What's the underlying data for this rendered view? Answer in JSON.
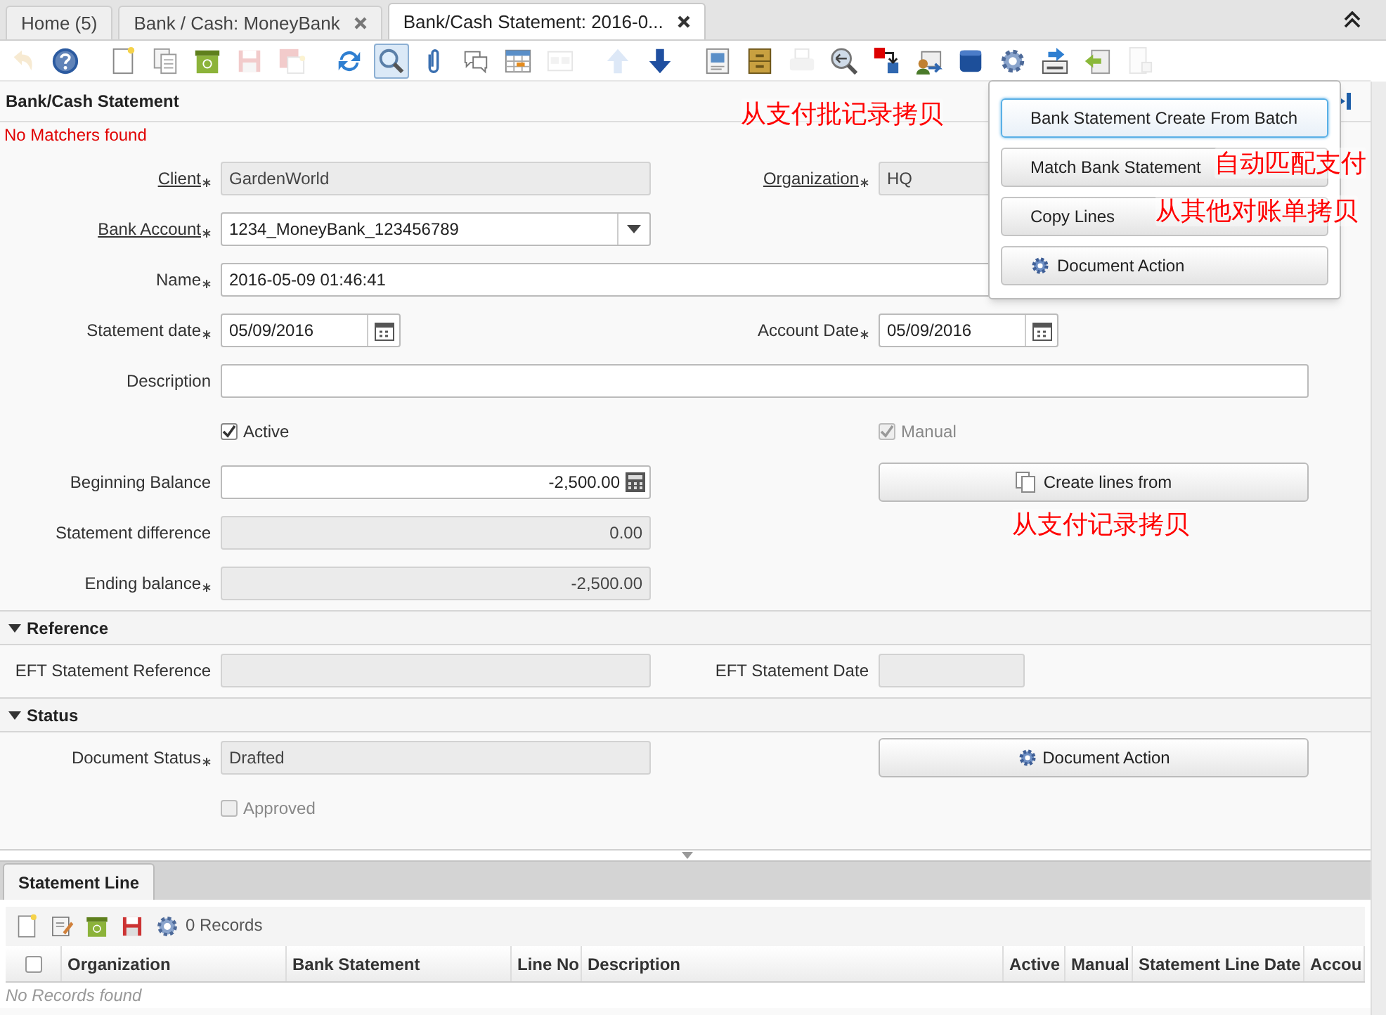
{
  "tabs": [
    {
      "label": "Home (5)",
      "closable": false,
      "selected": false
    },
    {
      "label": "Bank / Cash: MoneyBank",
      "closable": true,
      "selected": false
    },
    {
      "label": "Bank/Cash Statement: 2016-0...",
      "closable": true,
      "selected": true
    }
  ],
  "toolbar": [
    [
      {
        "kind": "undo",
        "disabled": true,
        "selected": false
      },
      {
        "kind": "help",
        "disabled": false,
        "selected": false
      }
    ],
    [
      {
        "kind": "new",
        "disabled": false,
        "selected": false
      },
      {
        "kind": "copy",
        "disabled": false,
        "selected": false
      },
      {
        "kind": "delete",
        "disabled": false,
        "selected": false
      },
      {
        "kind": "save",
        "disabled": true,
        "selected": false
      },
      {
        "kind": "savenew",
        "disabled": true,
        "selected": false
      }
    ],
    [
      {
        "kind": "refresh",
        "disabled": false,
        "selected": false
      },
      {
        "kind": "find",
        "disabled": false,
        "selected": true
      },
      {
        "kind": "attach",
        "disabled": false,
        "selected": false
      },
      {
        "kind": "chat",
        "disabled": false,
        "selected": false
      },
      {
        "kind": "grid",
        "disabled": false,
        "selected": false
      },
      {
        "kind": "form",
        "disabled": true,
        "selected": false
      }
    ],
    [
      {
        "kind": "up",
        "disabled": true,
        "selected": false
      },
      {
        "kind": "down",
        "disabled": false,
        "selected": false
      }
    ],
    [
      {
        "kind": "report",
        "disabled": false,
        "selected": false
      },
      {
        "kind": "archive",
        "disabled": false,
        "selected": false
      },
      {
        "kind": "print",
        "disabled": true,
        "selected": false
      },
      {
        "kind": "zoom",
        "disabled": false,
        "selected": false
      },
      {
        "kind": "workflow",
        "disabled": false,
        "selected": false
      },
      {
        "kind": "requests",
        "disabled": false,
        "selected": false
      },
      {
        "kind": "product",
        "disabled": false,
        "selected": false
      },
      {
        "kind": "process",
        "disabled": false,
        "selected": false
      },
      {
        "kind": "download",
        "disabled": false,
        "selected": false
      },
      {
        "kind": "import",
        "disabled": false,
        "selected": false
      },
      {
        "kind": "export",
        "disabled": true,
        "selected": false
      }
    ]
  ],
  "form": {
    "title": "Bank/Cash Statement",
    "message": "No Matchers found",
    "rows": [
      {
        "left": {
          "kind": "readonly",
          "label": "Client",
          "mandatory": true,
          "link": true,
          "value": "GardenWorld"
        },
        "right": {
          "kind": "readonly",
          "label": "Organization",
          "mandatory": true,
          "link": true,
          "value": "HQ"
        }
      },
      {
        "left": {
          "kind": "select",
          "label": "Bank Account",
          "mandatory": true,
          "link": true,
          "value": "1234_MoneyBank_123456789"
        }
      },
      {
        "wide": {
          "kind": "text",
          "label": "Name",
          "mandatory": true,
          "link": false,
          "value": "2016-05-09 01:46:41"
        }
      },
      {
        "left": {
          "kind": "date",
          "label": "Statement date",
          "mandatory": true,
          "link": false,
          "value": "05/09/2016"
        },
        "right": {
          "kind": "date",
          "label": "Account Date",
          "mandatory": true,
          "link": false,
          "value": "05/09/2016"
        }
      },
      {
        "wide": {
          "kind": "text",
          "label": "Description",
          "mandatory": false,
          "link": false
        }
      },
      {
        "left": {
          "kind": "checkbox",
          "label": "Active",
          "checked": true,
          "disabled": false
        },
        "right": {
          "kind": "checkbox",
          "label": "Manual",
          "checked": true,
          "disabled": true
        }
      },
      {
        "left": {
          "kind": "number",
          "label": "Beginning Balance",
          "mandatory": false,
          "link": false,
          "value": "-2,500.00"
        },
        "right": {
          "kind": "copy-button",
          "label": "Create lines from"
        }
      },
      {
        "left": {
          "kind": "readonly-number",
          "label": "Statement difference",
          "mandatory": false,
          "link": false,
          "value": "0.00"
        }
      },
      {
        "left": {
          "kind": "readonly-number",
          "label": "Ending balance",
          "mandatory": true,
          "link": false,
          "value": "-2,500.00"
        }
      }
    ],
    "sections": [
      {
        "title": "Reference",
        "expanded": true,
        "rows": [
          {
            "left": {
              "kind": "readonly",
              "label": "EFT Statement Reference",
              "mandatory": false,
              "link": false
            },
            "right": {
              "kind": "readonly-short",
              "label": "EFT Statement Date",
              "mandatory": false,
              "link": false
            }
          }
        ]
      },
      {
        "title": "Status",
        "expanded": true,
        "rows": [
          {
            "left": {
              "kind": "readonly",
              "label": "Document Status",
              "mandatory": true,
              "link": false,
              "value": "Drafted"
            },
            "right": {
              "kind": "action-button",
              "label": "Document Action"
            }
          },
          {
            "left": {
              "kind": "checkbox",
              "label": "Approved",
              "checked": false,
              "disabled": true
            }
          }
        ]
      }
    ]
  },
  "popup": [
    {
      "label": "Bank Statement Create From Batch",
      "kind": "plain",
      "selected": true
    },
    {
      "label": "Match Bank Statement",
      "kind": "plain",
      "selected": false
    },
    {
      "label": "Copy Lines",
      "kind": "plain",
      "selected": false
    },
    {
      "label": "Document Action",
      "kind": "action",
      "selected": false
    }
  ],
  "annotations": [
    "从支付批记录拷贝",
    "自动匹配支付",
    "从其他对账单拷贝",
    "从支付记录拷贝"
  ],
  "detail": {
    "tab": "Statement Line",
    "records": "0 Records",
    "toolbar": [
      {
        "kind": "new"
      },
      {
        "kind": "edit"
      },
      {
        "kind": "delete"
      },
      {
        "kind": "save"
      },
      {
        "kind": "process"
      }
    ],
    "select_all": {
      "checked": false
    },
    "columns": [
      "Organization",
      "Bank Statement",
      "Line No",
      "Description",
      "Active",
      "Manual",
      "Statement Line Date",
      "Accou"
    ],
    "empty": "No Records found"
  }
}
